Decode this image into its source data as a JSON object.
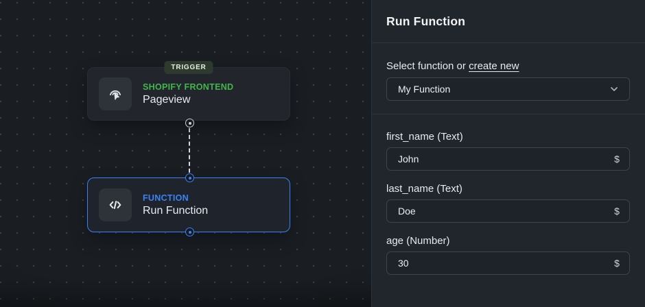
{
  "colors": {
    "accent_green": "#41b64b",
    "accent_blue": "#3b82f6",
    "canvas_bg": "#1a1e23",
    "panel_bg": "#21262d"
  },
  "canvas": {
    "trigger_node": {
      "badge": "TRIGGER",
      "type_label": "SHOPIFY FRONTEND",
      "title": "Pageview",
      "icon": "cursor-click-icon"
    },
    "function_node": {
      "type_label": "FUNCTION",
      "title": "Run Function",
      "icon": "code-icon",
      "selected": true
    }
  },
  "panel": {
    "title": "Run Function",
    "select_section": {
      "label_prefix": "Select function or",
      "create_new_label": "create new",
      "selected_value": "My Function",
      "chevron_icon": "chevron-down-icon"
    },
    "fields": [
      {
        "label": "first_name (Text)",
        "value": "John",
        "variable_button": "$"
      },
      {
        "label": "last_name (Text)",
        "value": "Doe",
        "variable_button": "$"
      },
      {
        "label": "age (Number)",
        "value": "30",
        "variable_button": "$"
      }
    ]
  }
}
